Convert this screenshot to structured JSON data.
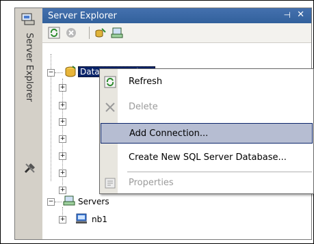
{
  "panel": {
    "title": "Server Explorer",
    "pin_icon": "pin-icon",
    "close_glyph": "✕"
  },
  "side_strip": {
    "label": "Server Explorer"
  },
  "toolbar": {
    "buttons": [
      "refresh-icon",
      "stop-icon",
      "connect-to-database-icon",
      "connect-to-server-icon"
    ]
  },
  "tree": {
    "root_label": "Data Connections",
    "servers_label": "Servers",
    "server_child": "nb1"
  },
  "context_menu": {
    "items": [
      {
        "label": "Refresh",
        "enabled": true,
        "highlighted": false
      },
      {
        "label": "Delete",
        "enabled": false,
        "highlighted": false
      },
      {
        "label": "Add Connection...",
        "enabled": true,
        "highlighted": true
      },
      {
        "label": "Create New SQL Server Database...",
        "enabled": true,
        "highlighted": false
      },
      {
        "label": "Properties",
        "enabled": false,
        "highlighted": false
      }
    ]
  },
  "colors": {
    "titlebar": "#3a6ea5",
    "selection": "#0a246a",
    "menu_highlight": "#b6bdd2"
  }
}
